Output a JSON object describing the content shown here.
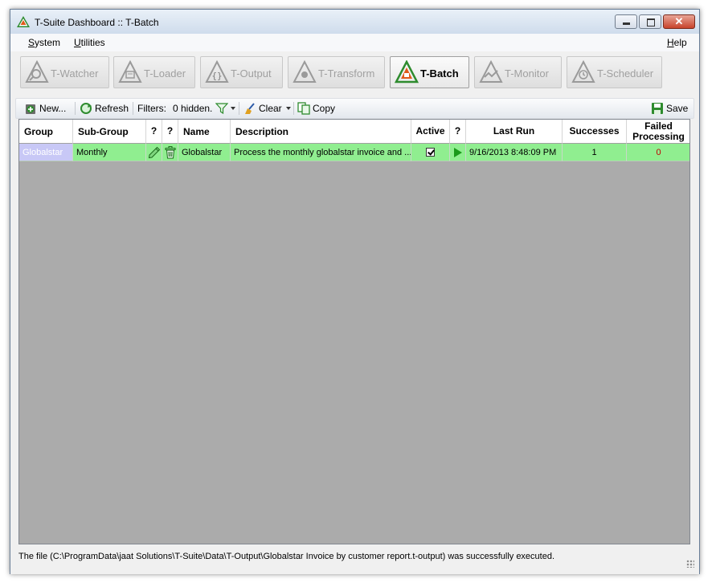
{
  "window": {
    "title": "T-Suite Dashboard :: T-Batch"
  },
  "menu": {
    "system": "System",
    "utilities": "Utilities",
    "help": "Help"
  },
  "modules": [
    {
      "label": "T-Watcher",
      "icon": "magnifier-icon",
      "active": false
    },
    {
      "label": "T-Loader",
      "icon": "loader-icon",
      "active": false
    },
    {
      "label": "T-Output",
      "icon": "braces-icon",
      "active": false
    },
    {
      "label": "T-Transform",
      "icon": "transform-icon",
      "active": false
    },
    {
      "label": "T-Batch",
      "icon": "batch-icon",
      "active": true
    },
    {
      "label": "T-Monitor",
      "icon": "monitor-icon",
      "active": false
    },
    {
      "label": "T-Scheduler",
      "icon": "clock-icon",
      "active": false
    }
  ],
  "toolbar": {
    "new_label": "New...",
    "refresh_label": "Refresh",
    "filters_label": "Filters:",
    "hidden_label": "0 hidden.",
    "clear_label": "Clear",
    "copy_label": "Copy",
    "save_label": "Save"
  },
  "table": {
    "headers": {
      "group": "Group",
      "subgroup": "Sub-Group",
      "q1": "?",
      "q2": "?",
      "name": "Name",
      "description": "Description",
      "active": "Active",
      "q3": "?",
      "last_run": "Last Run",
      "successes": "Successes",
      "failed": "Failed Processing"
    },
    "rows": [
      {
        "group": "Globalstar",
        "subgroup": "Monthly",
        "name": "Globalstar",
        "description": "Process the monthly globalstar invoice and ...",
        "active": true,
        "last_run": "9/16/2013 8:48:09 PM",
        "successes": "1",
        "failed": "0"
      }
    ]
  },
  "status": {
    "text": "The file (C:\\ProgramData\\jaat Solutions\\T-Suite\\Data\\T-Output\\Globalstar Invoice by customer report.t-output) was successfully executed."
  },
  "colors": {
    "row_green": "#90ee90",
    "selected_cell": "#c8c8f6",
    "grid_background": "#ababab",
    "failed_red": "#c00000",
    "edit_green": "#1a8a1a"
  }
}
